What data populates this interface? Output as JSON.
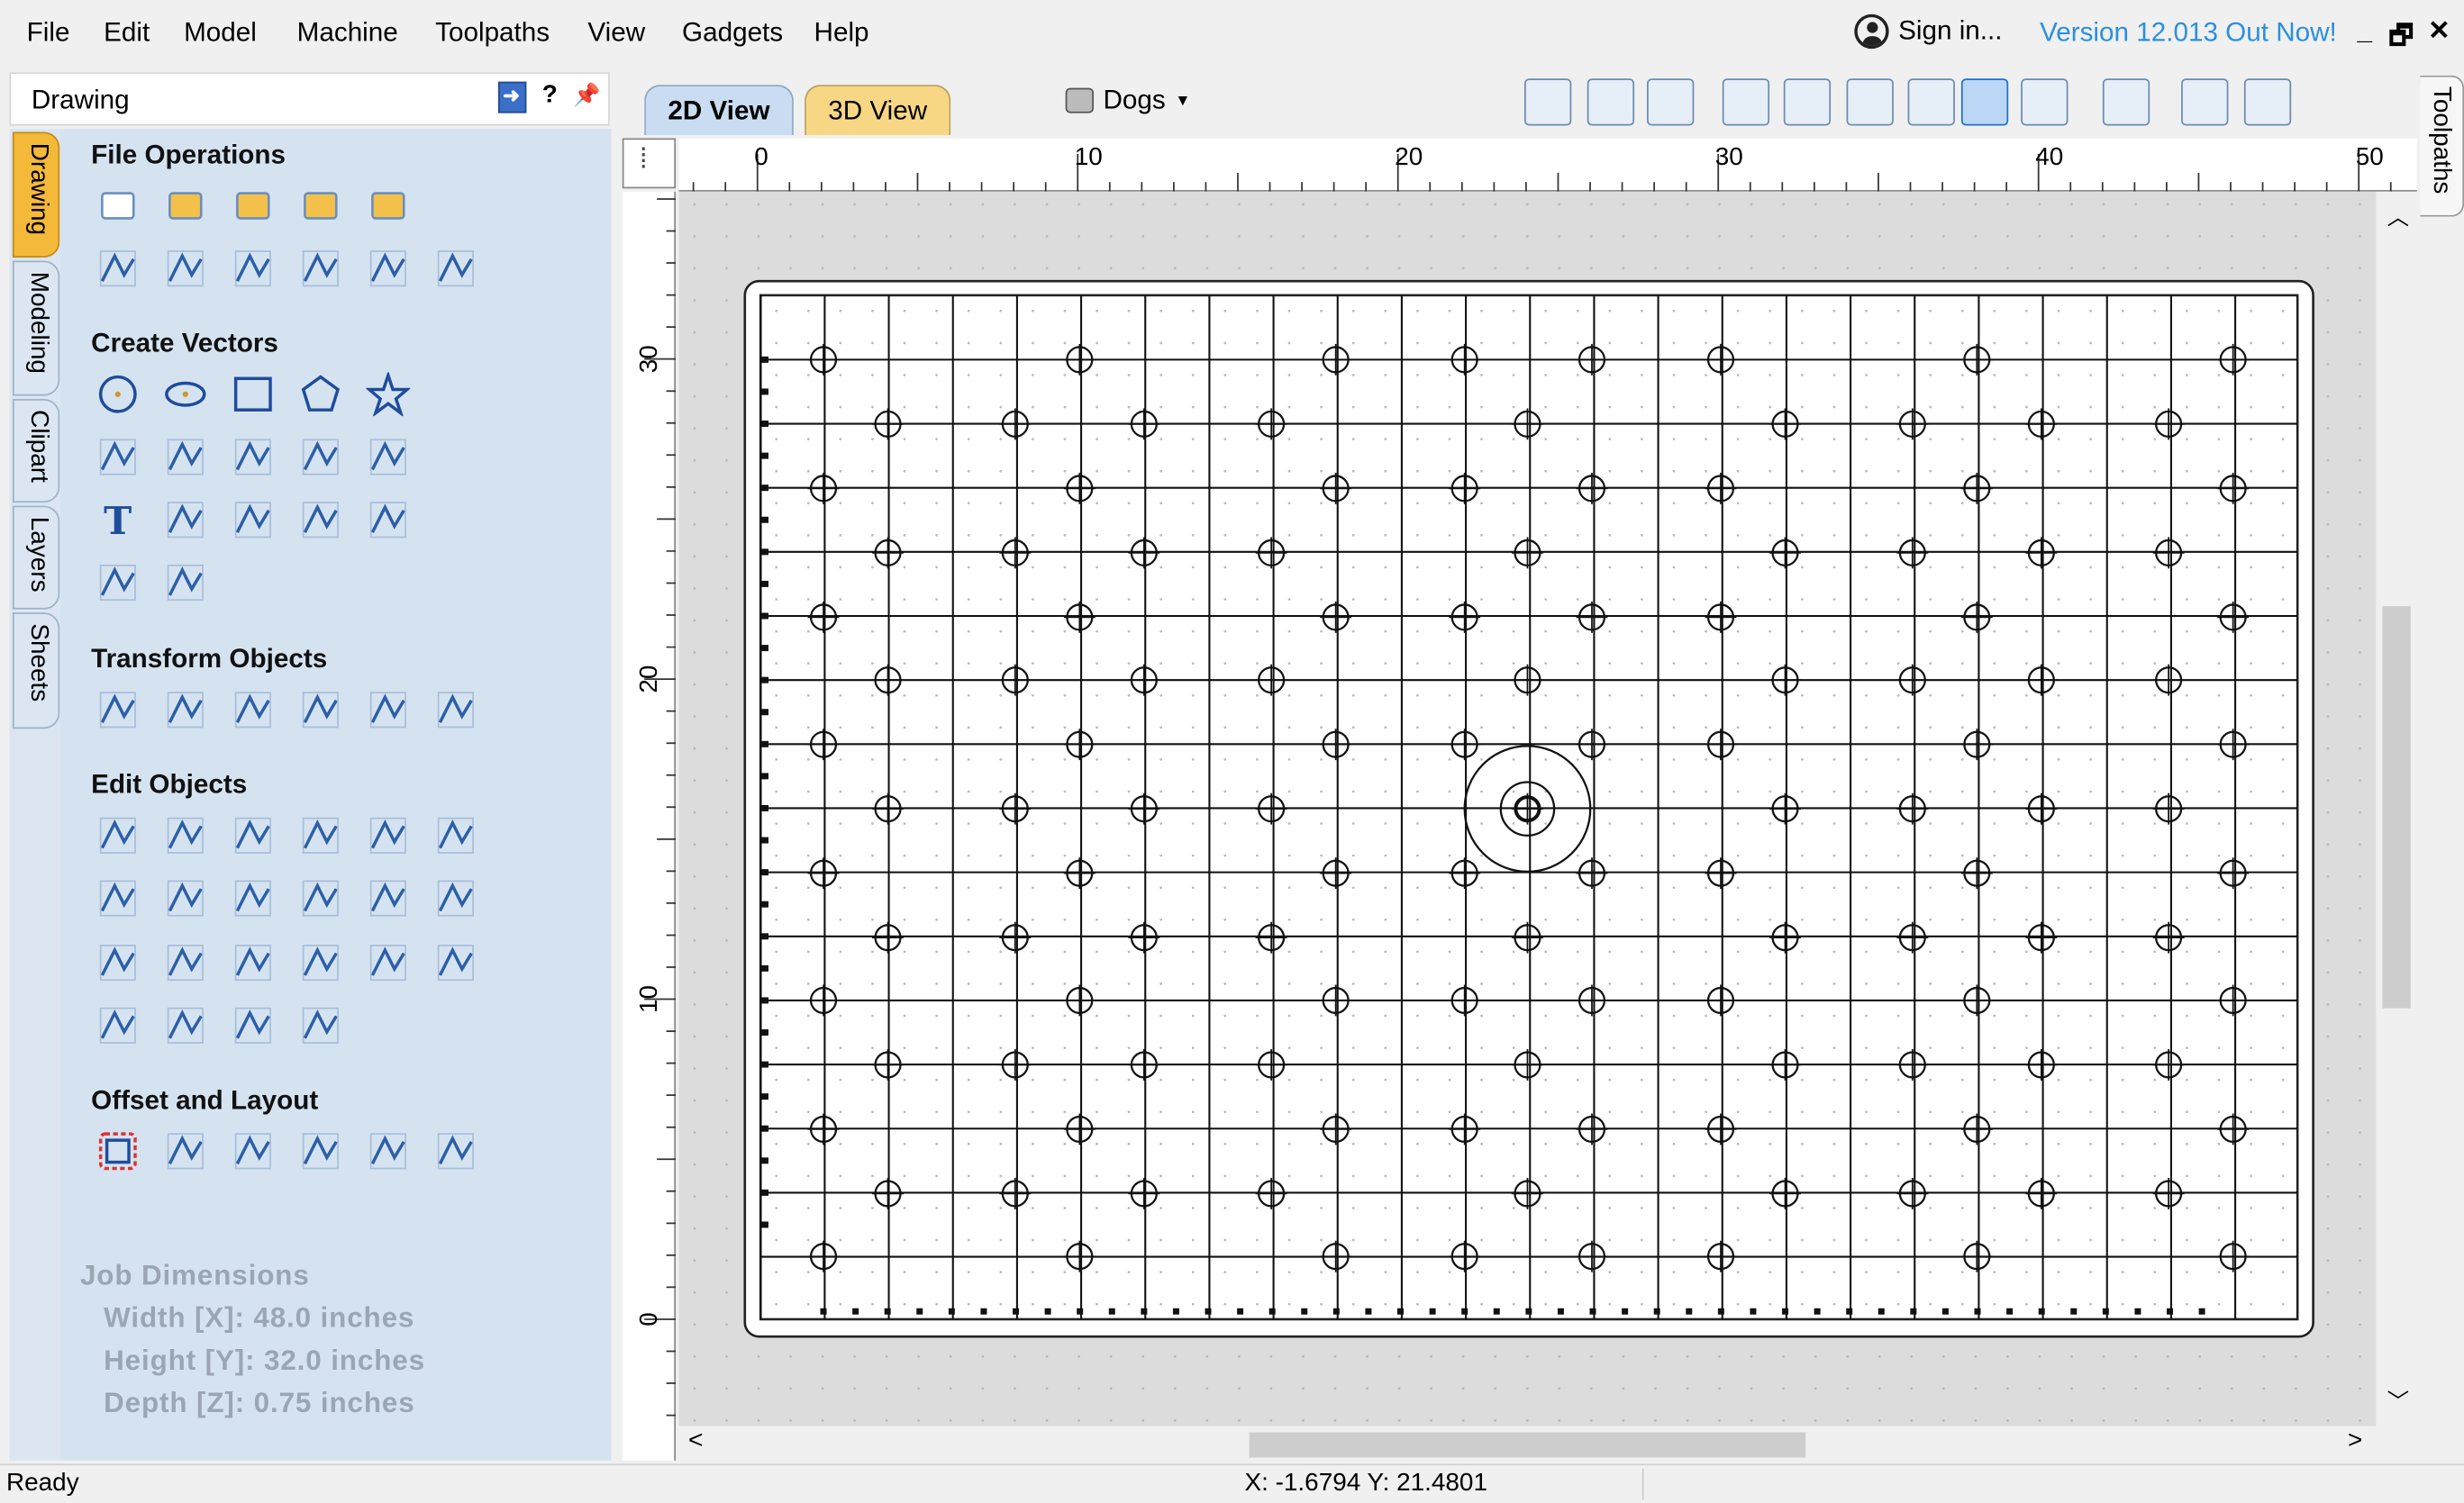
{
  "menu": [
    "File",
    "Edit",
    "Model",
    "Machine",
    "Toolpaths",
    "View",
    "Gadgets",
    "Help"
  ],
  "account": {
    "signin": "Sign in...",
    "version": "Version 12.013 Out Now!"
  },
  "window_controls": [
    "_",
    "🗗",
    "✕"
  ],
  "panel": {
    "title": "Drawing",
    "help": "?",
    "tabs": [
      "Drawing",
      "Modeling",
      "Clipart",
      "Layers",
      "Sheets"
    ],
    "sections": {
      "file_ops": "File Operations",
      "create_vectors": "Create Vectors",
      "transform": "Transform Objects",
      "edit": "Edit Objects",
      "offset": "Offset and Layout"
    },
    "job": {
      "title": "Job Dimensions",
      "width": "Width  [X]: 48.0 inches",
      "height": "Height [Y]: 32.0 inches",
      "depth": "Depth  [Z]: 0.75 inches"
    }
  },
  "views": {
    "tab2d": "2D View",
    "tab3d": "3D View",
    "layer": "Dogs"
  },
  "right_tab": "Toolpaths",
  "ruler": {
    "h_labels": [
      "0",
      "10",
      "20",
      "30",
      "40",
      "50"
    ],
    "v_labels": [
      "30",
      "20",
      "10",
      "0"
    ]
  },
  "status": {
    "left": "Ready",
    "coords": "X: -1.6794 Y: 21.4801"
  }
}
